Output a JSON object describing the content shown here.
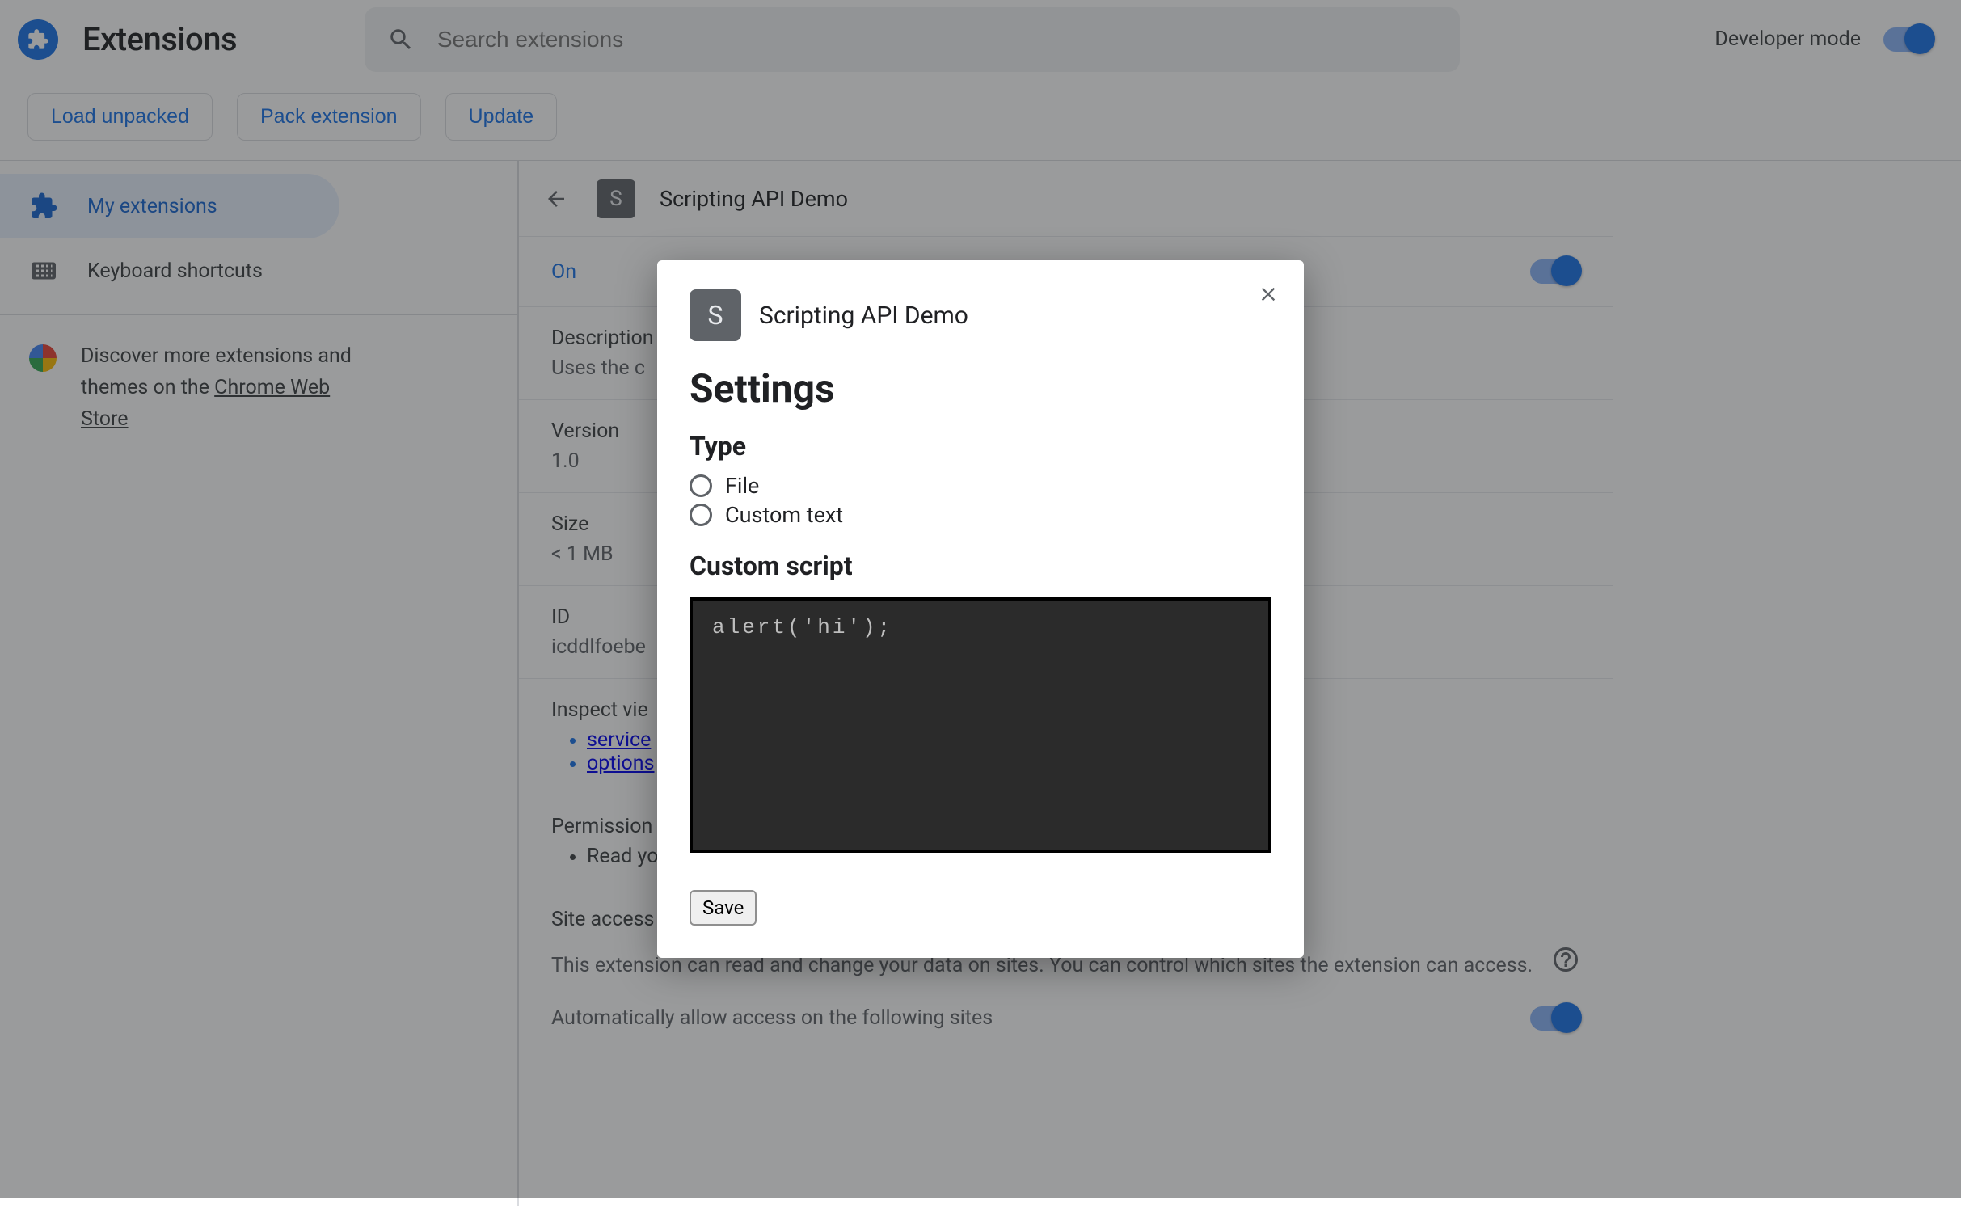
{
  "header": {
    "title": "Extensions",
    "search_placeholder": "Search extensions",
    "dev_mode_label": "Developer mode",
    "dev_mode_on": true
  },
  "actions": {
    "load_unpacked": "Load unpacked",
    "pack_extension": "Pack extension",
    "update": "Update"
  },
  "sidebar": {
    "my_extensions": "My extensions",
    "keyboard_shortcuts": "Keyboard shortcuts",
    "promo_prefix": "Discover more extensions and themes on the ",
    "promo_link": "Chrome Web Store"
  },
  "detail": {
    "title": "Scripting API Demo",
    "badge_letter": "S",
    "on_label": "On",
    "on_state": true,
    "description_label": "Description",
    "description_value": "Uses the c",
    "version_label": "Version",
    "version_value": "1.0",
    "size_label": "Size",
    "size_value": "< 1 MB",
    "id_label": "ID",
    "id_value": "icddlfoebe",
    "inspect_label": "Inspect vie",
    "inspect_links": [
      "service",
      "options"
    ],
    "permissions_label": "Permission",
    "permissions_items": [
      "Read yo"
    ],
    "site_access_label": "Site access",
    "site_access_text": "This extension can read and change your data on sites. You can control which sites the extension can access.",
    "auto_allow_text": "Automatically allow access on the following sites"
  },
  "dialog": {
    "badge_letter": "S",
    "ext_name": "Scripting API Demo",
    "heading": "Settings",
    "type_heading": "Type",
    "radio_file": "File",
    "radio_custom": "Custom text",
    "custom_heading": "Custom script",
    "code_value": "alert('hi');",
    "save_label": "Save"
  }
}
